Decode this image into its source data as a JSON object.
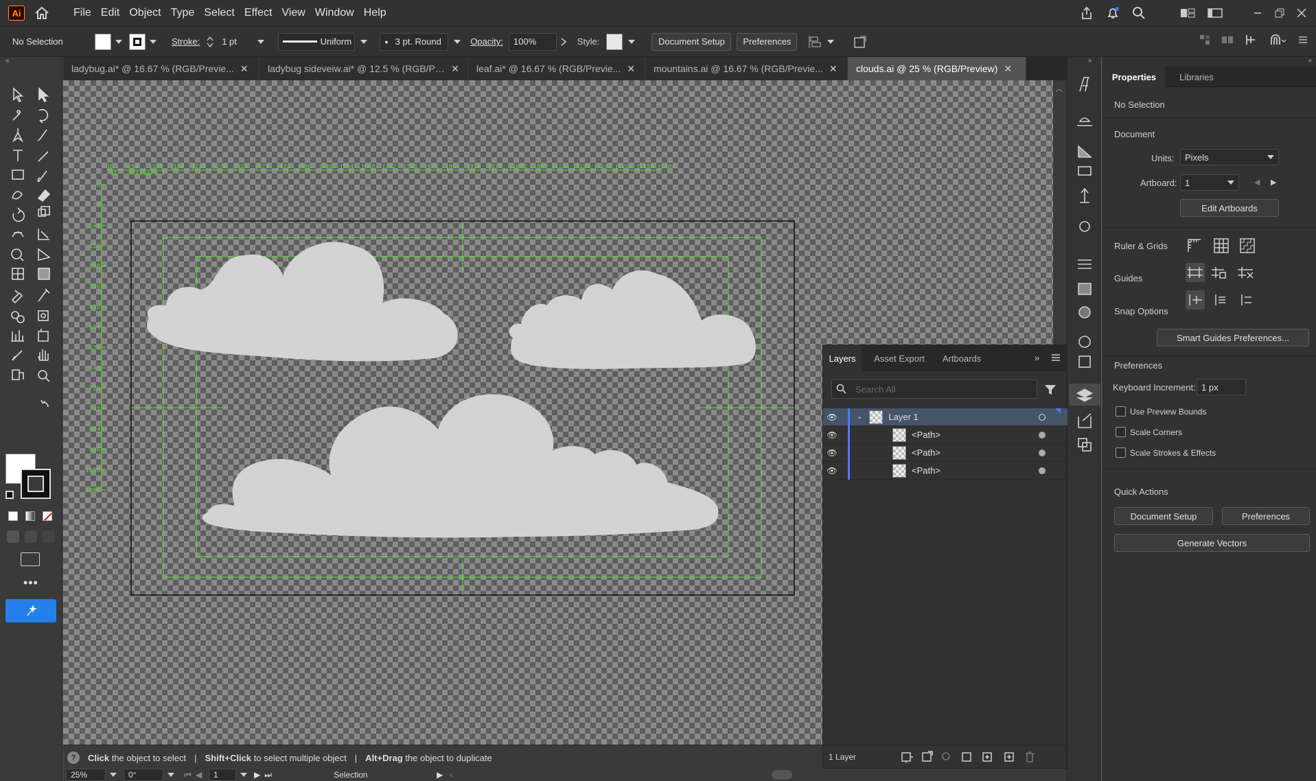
{
  "app": {
    "logo": "Ai"
  },
  "menu": [
    "File",
    "Edit",
    "Object",
    "Type",
    "Select",
    "Effect",
    "View",
    "Window",
    "Help"
  ],
  "control": {
    "selection_label": "No Selection",
    "stroke_label": "Stroke:",
    "stroke_value": "1 pt",
    "profile_label": "Uniform",
    "brush_label": "3 pt. Round",
    "opacity_label": "Opacity:",
    "opacity_value": "100%",
    "style_label": "Style:",
    "doc_setup": "Document Setup",
    "preferences": "Preferences"
  },
  "tabs": [
    {
      "label": "ladybug.ai* @ 16.67 % (RGB/Previe...",
      "active": false
    },
    {
      "label": "ladybug sideveiw.ai* @ 12.5 % (RGB/Pre...",
      "active": false
    },
    {
      "label": "leaf.ai* @ 16.67 % (RGB/Previe...",
      "active": false
    },
    {
      "label": "mountains.ai @ 16.67 % (RGB/Previe...",
      "active": false
    },
    {
      "label": "clouds.ai @ 25 % (RGB/Preview)",
      "active": true
    }
  ],
  "ruler": {
    "top_ticks": [
      "0",
      "54",
      "108",
      "162",
      "216",
      "270",
      "324",
      "378",
      "432",
      "486",
      "540",
      "594",
      "648",
      "702",
      "756",
      "810",
      "864",
      "918",
      "972",
      "1026",
      "1080",
      "1134",
      "1188",
      "1242",
      "1296",
      "1350",
      "1404"
    ],
    "left_ticks": [
      "0",
      "72",
      "144",
      "216",
      "288",
      "360",
      "432",
      "504",
      "576",
      "648",
      "720",
      "792",
      "864",
      "936",
      "1008",
      "1080"
    ],
    "artboard_label": "01 - Artboard 1"
  },
  "status": {
    "hint_parts": [
      {
        "bold": "Click",
        "rest": " the object to select"
      },
      {
        "bold": "Shift+Click",
        "rest": " to select multiple object"
      },
      {
        "bold": "Alt+Drag",
        "rest": " the object to duplicate"
      }
    ],
    "zoom": "25%",
    "rotation": "0°",
    "artboard_num": "1",
    "tool": "Selection"
  },
  "properties": {
    "tab_properties": "Properties",
    "tab_libraries": "Libraries",
    "no_selection": "No Selection",
    "document": "Document",
    "units_label": "Units:",
    "units_value": "Pixels",
    "artboard_label": "Artboard:",
    "artboard_value": "1",
    "edit_artboards": "Edit Artboards",
    "ruler_grids": "Ruler & Grids",
    "guides": "Guides",
    "snap_options": "Snap Options",
    "smart_guides_btn": "Smart Guides Preferences...",
    "preferences": "Preferences",
    "keyboard_increment_label": "Keyboard Increment:",
    "keyboard_increment_value": "1 px",
    "use_preview_bounds": "Use Preview Bounds",
    "scale_corners": "Scale Corners",
    "scale_strokes": "Scale Strokes & Effects",
    "quick_actions": "Quick Actions",
    "qa_doc_setup": "Document Setup",
    "qa_preferences": "Preferences",
    "generate_vectors": "Generate Vectors"
  },
  "layers_panel": {
    "tab_layers": "Layers",
    "tab_asset_export": "Asset Export",
    "tab_artboards": "Artboards",
    "search_placeholder": "Search All",
    "rows": [
      {
        "name": "Layer 1",
        "level": 0
      },
      {
        "name": "<Path>",
        "level": 1
      },
      {
        "name": "<Path>",
        "level": 1
      },
      {
        "name": "<Path>",
        "level": 1
      }
    ],
    "footer_count": "1 Layer"
  },
  "colors": {
    "accent": "#2680eb",
    "layer_color": "#4a7bff",
    "guide": "#5fdc3a",
    "cloud": "#d6d6d6"
  }
}
